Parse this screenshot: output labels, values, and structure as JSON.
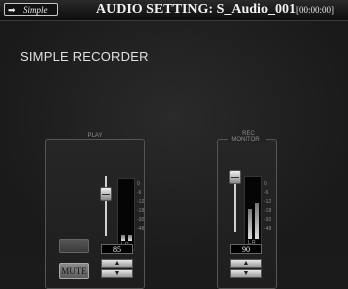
{
  "titlebar": {
    "mode_button_label": "Simple",
    "mode_button_icon": "arrow-right-icon",
    "title": "AUDIO SETTING: S_Audio_001",
    "time": "[00:00:00]"
  },
  "main": {
    "heading": "SIMPLE RECORDER"
  },
  "play_panel": {
    "title": "PLAY",
    "scale": [
      "0",
      "-6",
      "-12",
      "-18",
      "-30",
      "-48"
    ],
    "meter_label": "L R",
    "value": "85",
    "small_button_label": "",
    "mute_label": "MUTE",
    "up_icon": "triangle-up-icon",
    "down_icon": "triangle-down-icon"
  },
  "rec_panel": {
    "title_line1": "REC",
    "title_line2": "MONITOR",
    "scale": [
      "0",
      "-6",
      "-12",
      "-18",
      "-30",
      "-48"
    ],
    "meter_label": "L R",
    "value": "90",
    "up_icon": "triangle-up-icon",
    "down_icon": "triangle-down-icon"
  },
  "colors": {
    "background": "#1b1b1b",
    "text": "#e0e0e0",
    "panel_border": "#555555"
  }
}
